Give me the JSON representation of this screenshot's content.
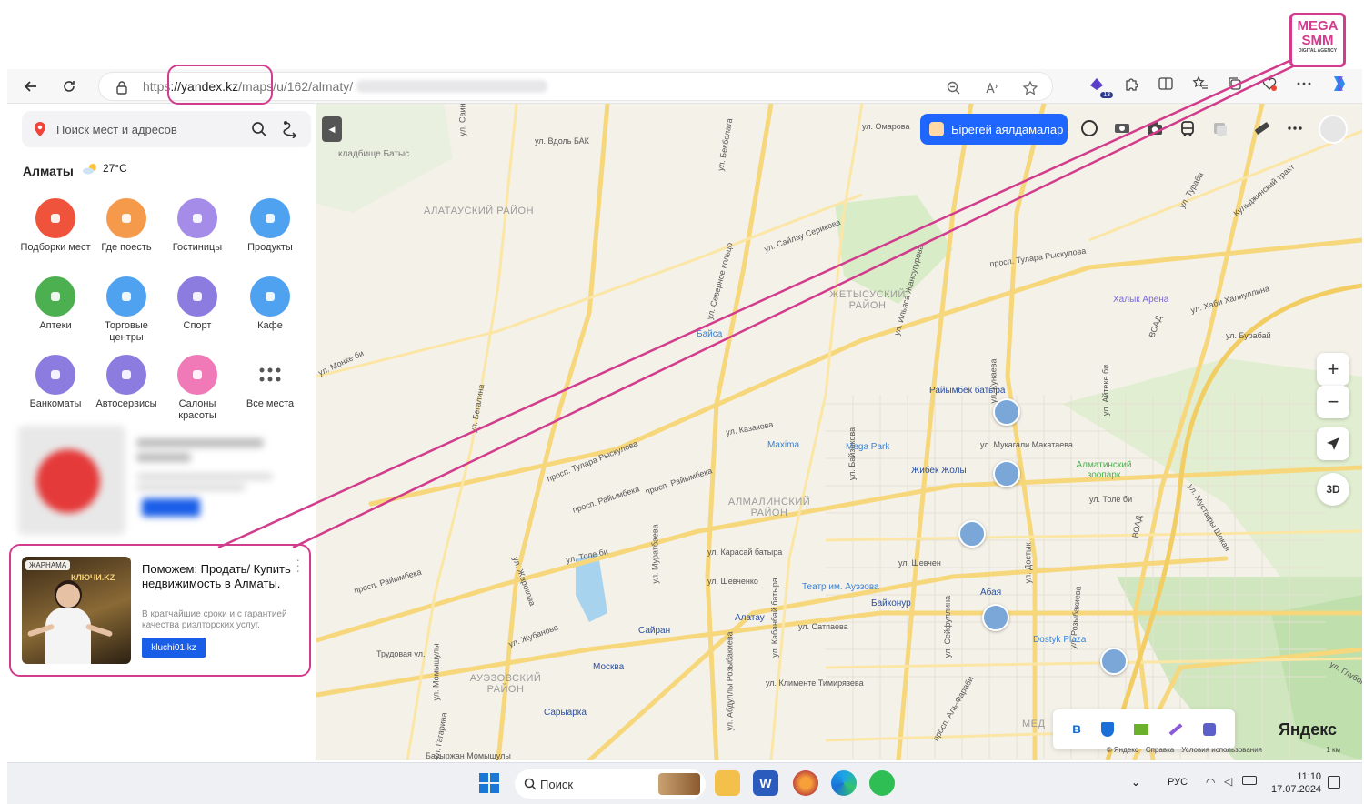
{
  "browser": {
    "url_scheme": "https",
    "url_domain": "://yandex.kz",
    "url_path": "/maps/",
    "url_rest": "u/162/almaty/",
    "extension_badge": "13"
  },
  "sidebar": {
    "search_placeholder": "Поиск мест и адресов",
    "city": "Алматы",
    "temperature": "27°C",
    "categories": [
      {
        "label": "Подборки мест",
        "color": "#f0533c",
        "icon": "collection-icon"
      },
      {
        "label": "Где поесть",
        "color": "#f59a4b",
        "icon": "fork-knife-icon"
      },
      {
        "label": "Гостиницы",
        "color": "#a48ce8",
        "icon": "bed-icon"
      },
      {
        "label": "Продукты",
        "color": "#4fa2f0",
        "icon": "basket-icon"
      },
      {
        "label": "Аптеки",
        "color": "#4caf50",
        "icon": "pill-icon"
      },
      {
        "label": "Торговые центры",
        "color": "#4fa2f0",
        "icon": "bag-icon"
      },
      {
        "label": "Спорт",
        "color": "#8c7ce0",
        "icon": "dumbbell-icon"
      },
      {
        "label": "Кафе",
        "color": "#4fa2f0",
        "icon": "cup-icon"
      },
      {
        "label": "Банкоматы",
        "color": "#8c7ce0",
        "icon": "coins-icon"
      },
      {
        "label": "Автосервисы",
        "color": "#8c7ce0",
        "icon": "car-icon"
      },
      {
        "label": "Салоны красоты",
        "color": "#f07ab7",
        "icon": "scissors-icon"
      },
      {
        "label": "Все места",
        "color": "#666666",
        "icon": "grid-icon"
      }
    ],
    "ad": {
      "tag": "ЖАРНАМА",
      "image_text": "КЛЮЧИ.KZ",
      "title": "Поможем: Продать/ Купить недвижимость в Алматы.",
      "desc": "В кратчайшие сроки и с гарантией качества риэлторских услуг.",
      "button": "kluchi01.kz"
    }
  },
  "map": {
    "promo_button": "Бірегей аялдамалар",
    "zoom_in": "+",
    "zoom_out": "−",
    "btn_3d": "3D",
    "logo": "Яндекс",
    "copyright": "© Яндекс",
    "help": "Справка",
    "terms": "Условия использования",
    "scale": "1 км",
    "areas": [
      "АЛАТАУСКИЙ РАЙОН",
      "ЖЕТЫСУСКИЙ РАЙОН",
      "АЛМАЛИНСКИЙ РАЙОН",
      "АУЭЗОВСКИЙ РАЙОН",
      "МЕД"
    ],
    "pois": {
      "cemetery": "кладбище Батыс",
      "arena": "Халык Арена",
      "zoo": "Алматинский зоопарк",
      "maxima": "Maxima",
      "megapark": "Mega Park",
      "dostyk": "Dostyk Plaza",
      "theatre": "Театр им. Ауэзова",
      "raiymbek": "Райымбек батыра",
      "zhibek": "Жибек Жолы",
      "abai": "Абая",
      "baikonur": "Байконур",
      "almaty": "Алатау",
      "sairan": "Сайран",
      "moskva": "Москва",
      "saryarka": "Сарыарка",
      "baisa": "Байса"
    },
    "streets": {
      "s1": "ул. Саина",
      "s2": "ул. Вдоль БАК",
      "s3": "ул. Бекболата",
      "s4": "просп. Райымбека",
      "s5": "просп. Тулара Рыскулова",
      "s6": "ул. Толе би",
      "s7": "ул. Шевченко",
      "s8": "ул. Карасай батыра",
      "s9": "ул. Мукагали Макатаева",
      "s10": "ул. Кабанбай батыра",
      "s11": "ул. Жубанова",
      "s12": "ул. Сатпаева",
      "s13": "ул. Клименте Тимирязева",
      "s14": "ул. Абдуллы Розыбакиева",
      "s15": "ул. Розыбакиева",
      "s16": "просп. Аль-Фараби",
      "s17": "ВОАД",
      "s18": "ул. Хаби Халиуллина",
      "s19": "ул. Бурабай",
      "s20": "Трудовая ул.",
      "s21": "ул. Казакова",
      "s22": "ул. Сейфуллина",
      "s23": "ул. Жарокова",
      "s24": "ул. Момышулы",
      "s25": "ул. Гагарина",
      "s26": "ул. Северное кольцо",
      "s27": "ул. Байзакова",
      "s28": "ул. Муратбаева",
      "s29": "ул. Айтеке би",
      "s30": "ул. Кунаева",
      "s31": "ул. Достык",
      "s32": "ул. Шевчен",
      "s33": "Бауыржан Момышулы",
      "s34": "ул. Мустафы Шокая",
      "s35": "Кульджинский тракт",
      "s36": "ул. Омарова",
      "s37": "ул. Сайлау Серикова",
      "s38": "ул. Ильяса Жансугурова",
      "s39": "ул. Бегалина",
      "s40": "ул. Монке би",
      "s41": "ул. Тураба",
      "s42": "ул. Глубокая Щель"
    }
  },
  "taskbar": {
    "search_placeholder": "Поиск",
    "lang": "РУС",
    "time": "11:10",
    "date": "17.07.2024"
  },
  "overlay": {
    "logo_line1": "MEGA",
    "logo_line2": "SMM",
    "logo_sub": "DIGITAL AGENCY"
  },
  "colors": {
    "accent": "#d23c8c",
    "map_bg": "#f4f1e8",
    "road_yellow": "#f7d77b",
    "promo": "#1f66ff"
  }
}
